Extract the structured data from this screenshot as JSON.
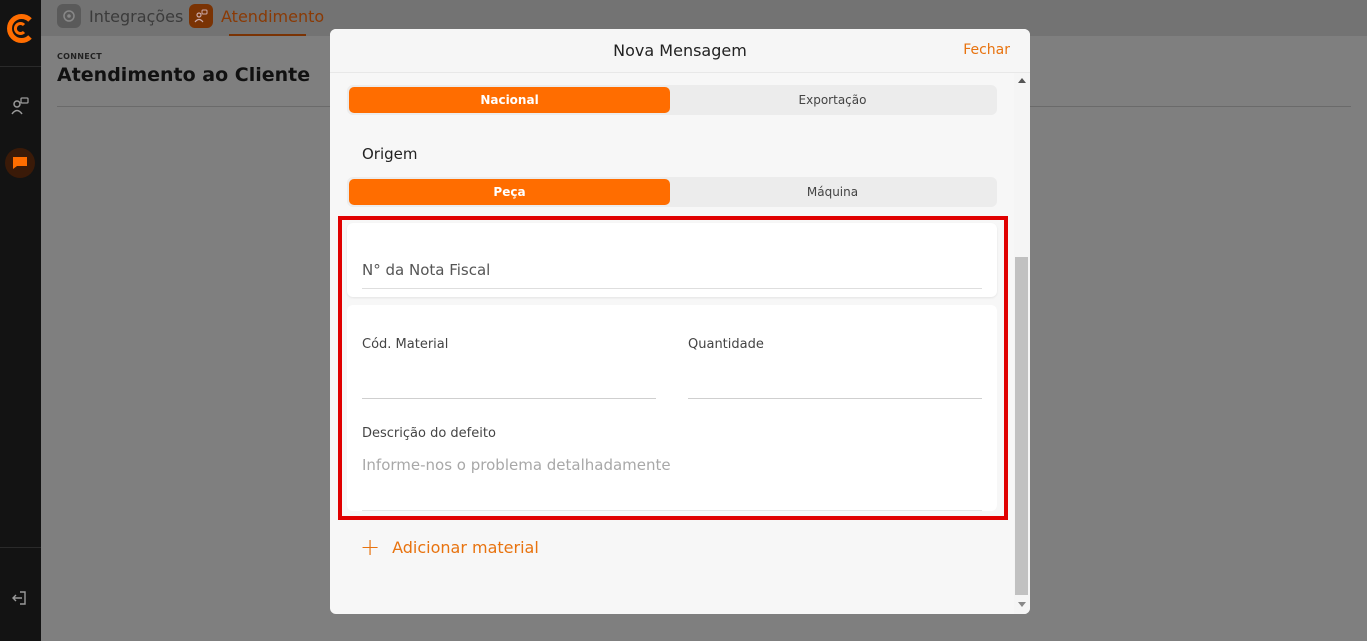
{
  "nav": {
    "tab_integracoes": "Integrações",
    "tab_atendimento": "Atendimento"
  },
  "page": {
    "section_label": "CONNECT",
    "title": "Atendimento ao Cliente"
  },
  "modal": {
    "title": "Nova Mensagem",
    "close_label": "Fechar",
    "market_toggle": {
      "options": [
        "Nacional",
        "Exportação"
      ],
      "selected": "Nacional"
    },
    "origem": {
      "label": "Origem",
      "options": [
        "Peça",
        "Máquina"
      ],
      "selected": "Peça"
    },
    "form": {
      "nota_fiscal_placeholder": "N° da Nota Fiscal",
      "cod_material_label": "Cód. Material",
      "quantidade_label": "Quantidade",
      "descricao_label": "Descrição do defeito",
      "descricao_placeholder": "Informe-nos o problema detalhadamente"
    },
    "add_material_label": "Adicionar material"
  },
  "colors": {
    "accent": "#ff6d00",
    "link": "#e8730f",
    "highlight": "#e00000"
  }
}
